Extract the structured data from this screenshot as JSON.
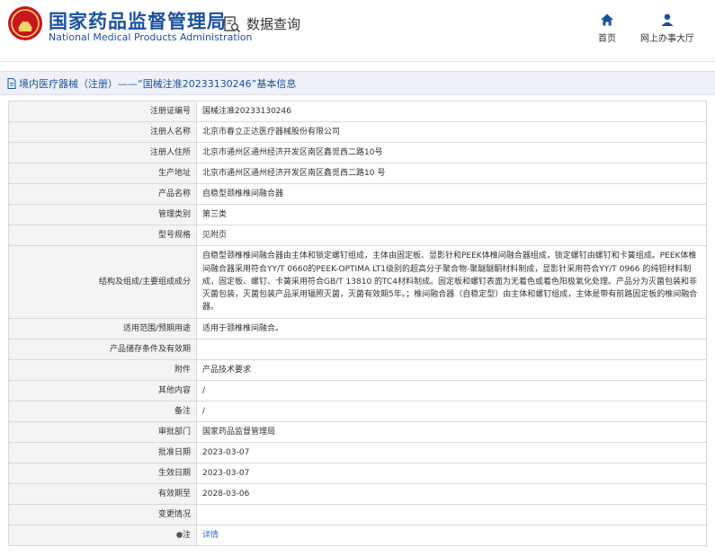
{
  "header": {
    "brand_cn": "国家药品监督管理局",
    "brand_en": "National Medical Products Administration",
    "query_title": "数据查询",
    "nav": [
      {
        "label": "首页",
        "icon": "home-icon"
      },
      {
        "label": "网上办事大厅",
        "icon": "user-icon"
      }
    ]
  },
  "breadcrumb": {
    "text": "境内医疗器械（注册）——“国械注准20233130246”基本信息"
  },
  "table": {
    "rows": [
      {
        "label": "注册证编号",
        "value": "国械注准20233130246"
      },
      {
        "label": "注册人名称",
        "value": "北京市春立正达医疗器械股份有限公司"
      },
      {
        "label": "注册人住所",
        "value": "北京市通州区通州经济开发区南区鑫觅西二路10号"
      },
      {
        "label": "生产地址",
        "value": "北京市通州区通州经济开发区南区鑫觅西二路10 号"
      },
      {
        "label": "产品名称",
        "value": "自稳型颈椎椎间融合器"
      },
      {
        "label": "管理类别",
        "value": "第三类"
      },
      {
        "label": "型号规格",
        "value": "见附页"
      },
      {
        "label": "结构及组成/主要组成成分",
        "value": "自稳型颈椎椎间融合器由主体和锁定螺钉组成，主体由固定板、显影针和PEEK体椎间融合器组成，锁定螺钉由螺钉和卡簧组成。PEEK体椎间融合器采用符合YY/T 0660的PEEK-OPTIMA LT1级别的超高分子聚合物-聚醚醚酮材料制成，显影针采用符合YY/T 0966 的纯钽材料制成，固定板、螺钉、卡簧采用符合GB/T 13810 的TC4材料制成。固定板和螺钉表面为无着色或着色阳极氧化处理。产品分为灭菌包装和非灭菌包装，灭菌包装产品采用辐照灭菌，灭菌有效期5年。；椎间融合器（自稳定型）由主体和螺钉组成，主体是带有前路固定板的椎间融合器。"
      },
      {
        "label": "适用范围/预期用途",
        "value": "适用于颈椎椎间融合。"
      },
      {
        "label": "产品储存条件及有效期",
        "value": ""
      },
      {
        "label": "附件",
        "value": "产品技术要求"
      },
      {
        "label": "其他内容",
        "value": "/"
      },
      {
        "label": "备注",
        "value": "/"
      },
      {
        "label": "审批部门",
        "value": "国家药品监督管理局"
      },
      {
        "label": "批准日期",
        "value": "2023-03-07"
      },
      {
        "label": "生效日期",
        "value": "2023-03-07"
      },
      {
        "label": "有效期至",
        "value": "2028-03-06"
      },
      {
        "label": "变更情况",
        "value": ""
      },
      {
        "label": "注",
        "value": "详情",
        "link": true
      }
    ]
  },
  "colors": {
    "brand": "#1a52a0",
    "accent_red": "#c8161d",
    "link": "#2b6dc8",
    "label_bg": "#f4f4f4"
  }
}
